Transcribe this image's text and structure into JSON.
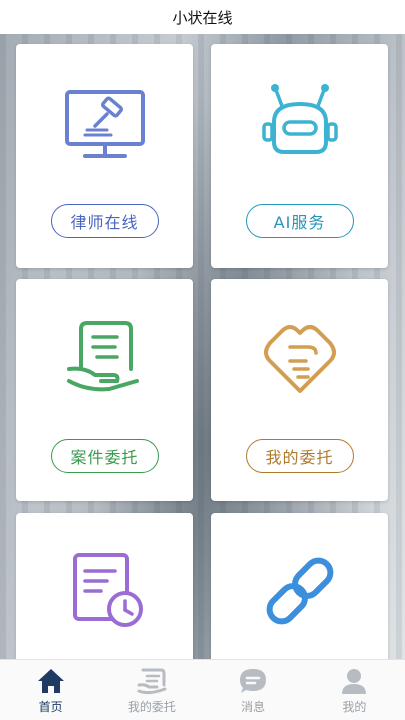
{
  "header": {
    "title": "小状在线"
  },
  "cards": [
    {
      "label": "律师在线",
      "icon": "judge-gavel-monitor-icon"
    },
    {
      "label": "AI服务",
      "icon": "robot-icon"
    },
    {
      "label": "案件委托",
      "icon": "case-hand-document-icon"
    },
    {
      "label": "我的委托",
      "icon": "handshake-icon"
    },
    {
      "label": "",
      "icon": "document-clock-icon"
    },
    {
      "label": "",
      "icon": "link-icon"
    }
  ],
  "tabbar": {
    "items": [
      {
        "label": "首页",
        "icon": "home-icon",
        "active": true
      },
      {
        "label": "我的委托",
        "icon": "commission-icon",
        "active": false
      },
      {
        "label": "消息",
        "icon": "message-icon",
        "active": false
      },
      {
        "label": "我的",
        "icon": "user-icon",
        "active": false
      }
    ]
  },
  "colors": {
    "blue": "#6a80d0",
    "cyan": "#3cb3d3",
    "green": "#4aa763",
    "gold": "#d39d52",
    "purple": "#9b6cd4",
    "link_blue": "#3b8fdc",
    "tab_active": "#1f3b63",
    "tab_inactive": "#b7bcc2"
  }
}
